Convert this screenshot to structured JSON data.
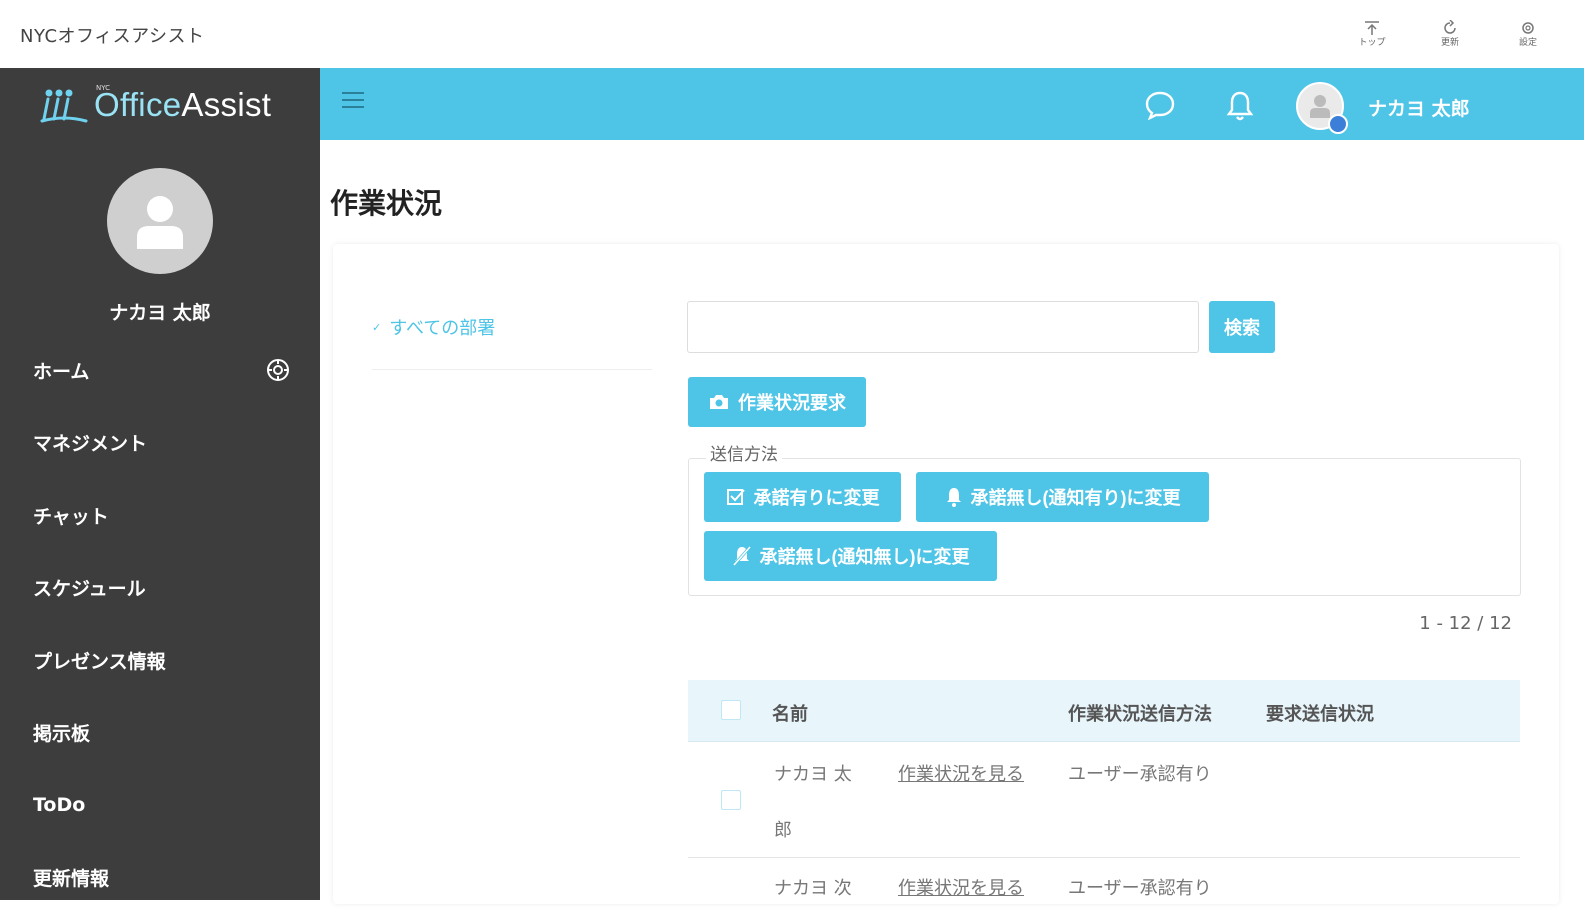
{
  "app": {
    "title": "NYCオフィスアシスト",
    "sys_buttons": [
      {
        "label": "トップ"
      },
      {
        "label": "更新"
      },
      {
        "label": "設定"
      }
    ]
  },
  "sidebar": {
    "logo_text_o": "Office",
    "logo_text_rest": "Assist",
    "logo_small": "NYC",
    "user_name": "ナカヨ 太郎",
    "items": [
      {
        "label": "ホーム"
      },
      {
        "label": "マネジメント"
      },
      {
        "label": "チャット"
      },
      {
        "label": "スケジュール"
      },
      {
        "label": "プレゼンス情報"
      },
      {
        "label": "掲示板"
      },
      {
        "label": "ToDo"
      },
      {
        "label": "更新情報"
      }
    ]
  },
  "header": {
    "user_name": "ナカヨ 太郎",
    "colors": {
      "accent": "#4ec4e6",
      "sidebar": "#3d3d3d",
      "presence": "#3b7fd9"
    }
  },
  "main": {
    "page_title": "作業状況",
    "department": "すべての部署",
    "search": {
      "value": "",
      "button": "検索"
    },
    "request_button": "作業状況要求",
    "send_method": {
      "legend": "送信方法",
      "buttons": [
        {
          "label": "承諾有りに変更"
        },
        {
          "label": "承諾無し(通知有り)に変更"
        },
        {
          "label": "承諾無し(通知無し)に変更"
        }
      ]
    },
    "pagination": "1 - 12 / 12",
    "table": {
      "headers": {
        "name": "名前",
        "method": "作業状況送信方法",
        "status": "要求送信状況"
      },
      "rows": [
        {
          "name_line1": "ナカヨ 太",
          "name_line2": "郎",
          "link": "作業状況を見る",
          "method": "ユーザー承認有り",
          "status": ""
        },
        {
          "name_line1": "ナカヨ 次",
          "link": "作業状況を見る",
          "method": "ユーザー承認有り",
          "status": ""
        }
      ]
    }
  }
}
